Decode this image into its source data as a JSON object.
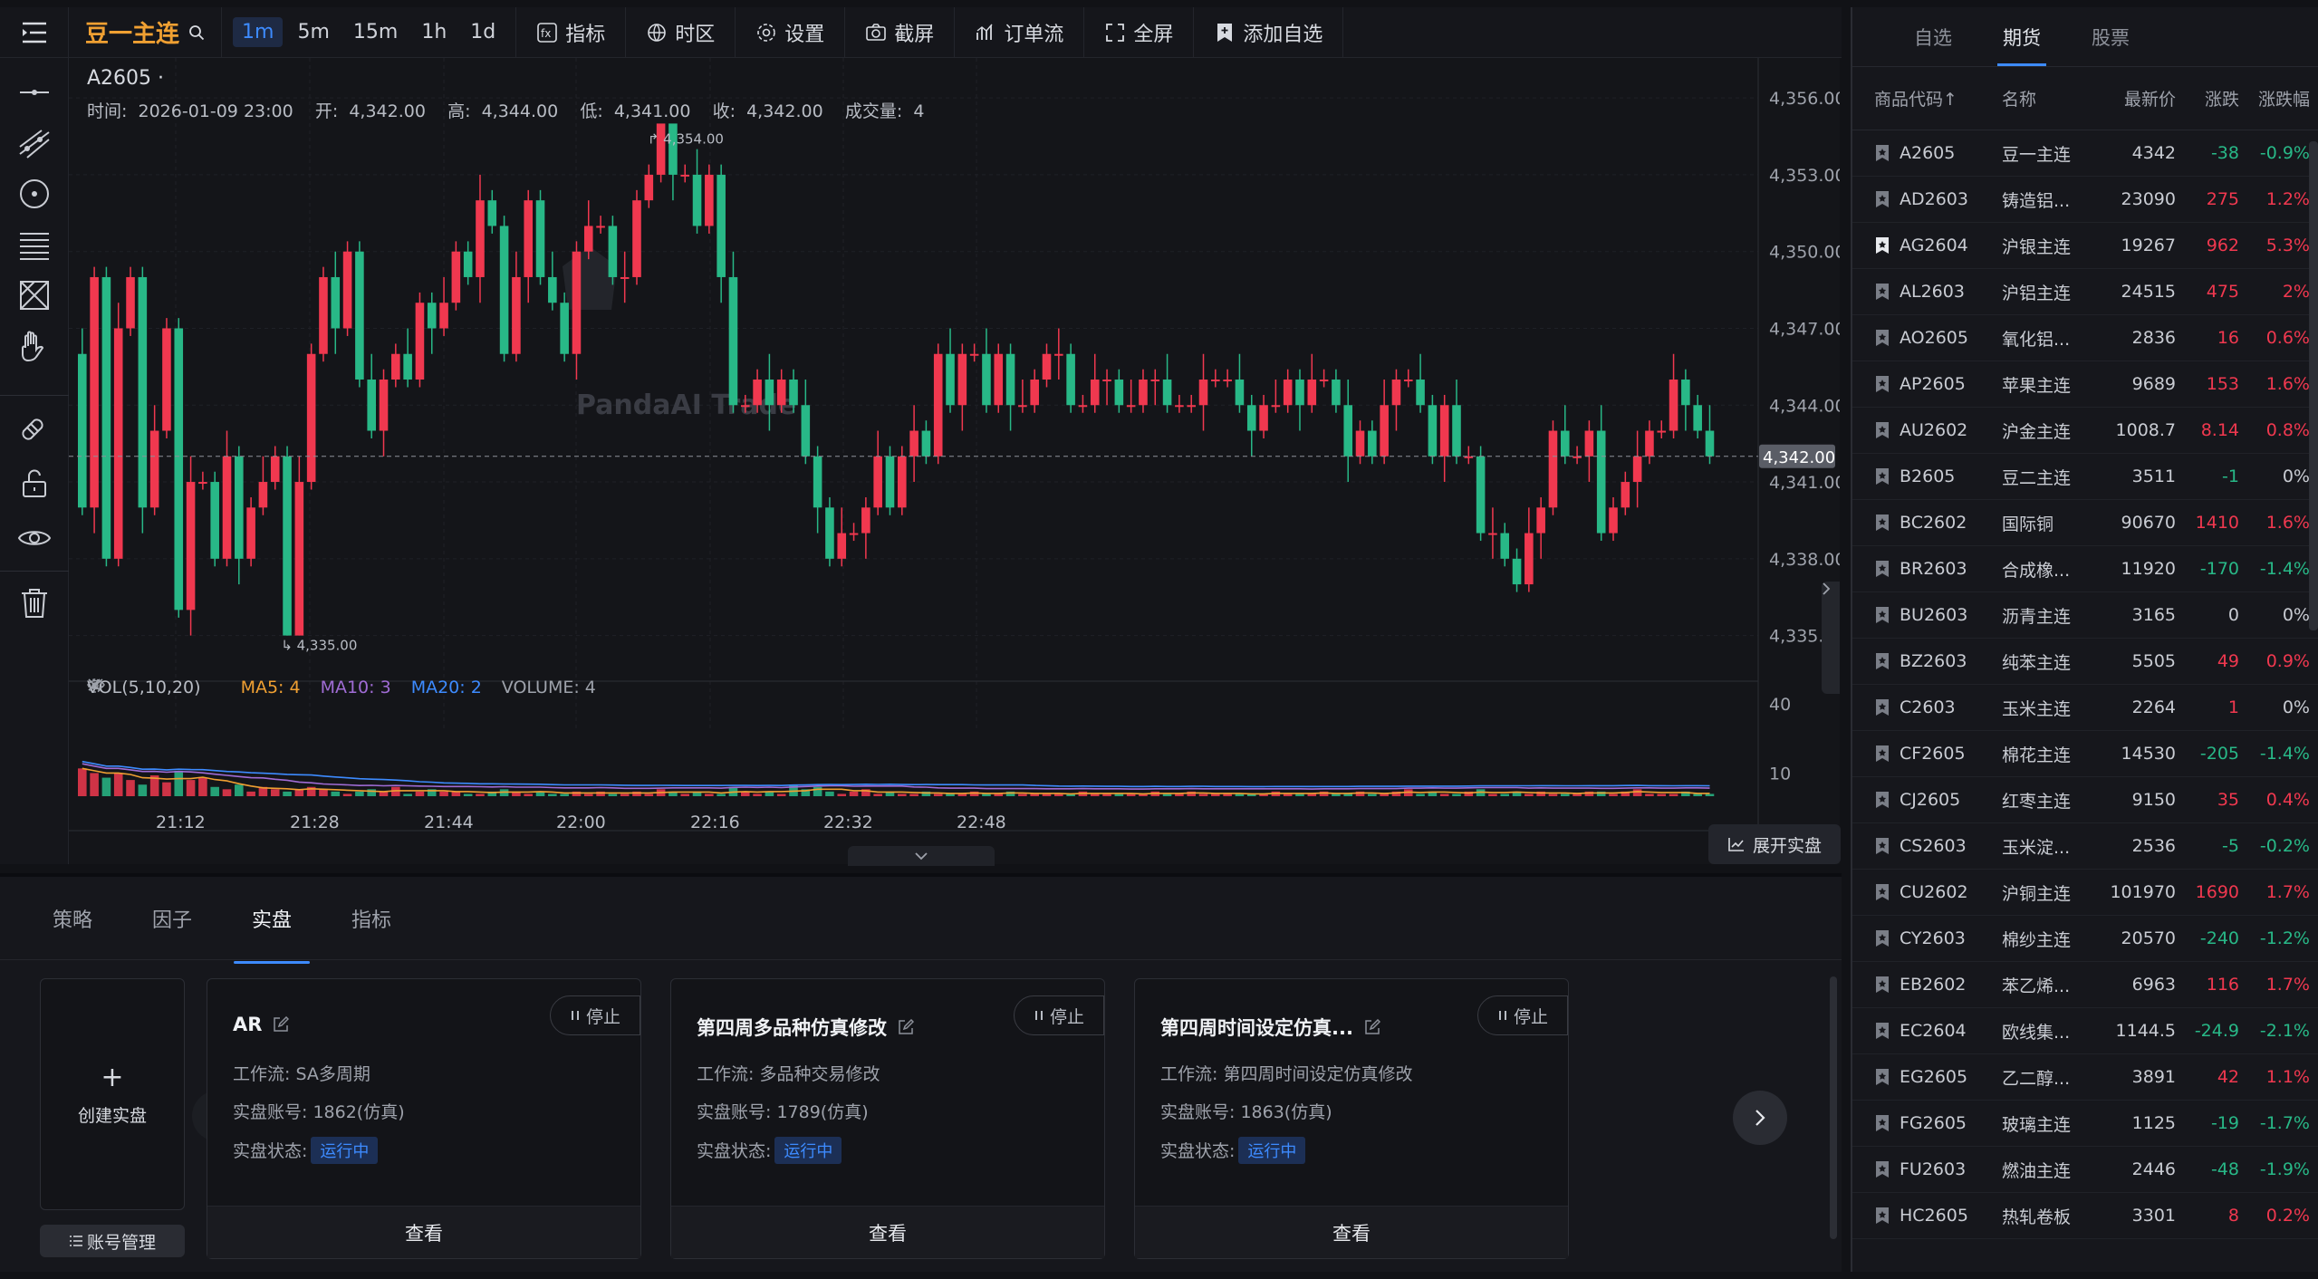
{
  "toolbar": {
    "symbol_name": "豆一主连",
    "periods": [
      "1m",
      "5m",
      "15m",
      "1h",
      "1d"
    ],
    "active_period": "1m",
    "tools": [
      {
        "label": "指标",
        "icon": "fx-icon"
      },
      {
        "label": "时区",
        "icon": "globe-icon"
      },
      {
        "label": "设置",
        "icon": "gear-icon"
      },
      {
        "label": "截屏",
        "icon": "camera-icon"
      },
      {
        "label": "订单流",
        "icon": "orderflow-icon"
      },
      {
        "label": "全屏",
        "icon": "fullscreen-icon"
      },
      {
        "label": "添加自选",
        "icon": "bookmark-add-icon"
      }
    ]
  },
  "chart": {
    "symbol_label": "A2605 ·",
    "ohlc_text": "时间:  2026-01-09 23:00    开:  4,342.00    高:  4,344.00    低:  4,341.00    收:  4,342.00    成交量:  4",
    "watermark": "PandaAI Trade",
    "last_price_label": "4,342.00",
    "high_marker": "4,354.00",
    "low_marker": "4,335.00",
    "vol_legend": {
      "title": "VOL(5,10,20)",
      "ma5": "MA5: 4",
      "ma10": "MA10: 3",
      "ma20": "MA20: 2",
      "volume": "VOLUME: 4"
    },
    "expand_label": "展开实盘"
  },
  "chart_data": {
    "type": "candlestick",
    "symbol": "A2605",
    "interval": "1m",
    "y_ticks": [
      "4,356.00",
      "4,353.00",
      "4,350.00",
      "4,347.00",
      "4,344.00",
      "4,341.00",
      "4,338.00",
      "4,335.00"
    ],
    "vol_ticks": [
      "40",
      "10"
    ],
    "x_ticks": [
      "21:12",
      "21:28",
      "21:44",
      "22:00",
      "22:16",
      "22:32",
      "22:48"
    ],
    "ylim": [
      4333.5,
      4356.5
    ],
    "last_close": 4342,
    "high": 4354,
    "low": 4335,
    "colors": {
      "up": "#f0384f",
      "down": "#28b887"
    },
    "series": [
      {
        "name": "close",
        "values": [
          4340,
          4349,
          4338,
          4347,
          4349,
          4340,
          4343,
          4347,
          4336,
          4341,
          4341,
          4338,
          4342,
          4338,
          4340,
          4341,
          4342,
          4335,
          4341,
          4346,
          4349,
          4347,
          4350,
          4345,
          4343,
          4345,
          4346,
          4345,
          4348,
          4347,
          4348,
          4350,
          4349,
          4352,
          4351,
          4346,
          4349,
          4352,
          4349,
          4348,
          4346,
          4350,
          4351,
          4351,
          4349,
          4349,
          4352,
          4353,
          4355,
          4353,
          4353,
          4351,
          4353,
          4349,
          4344,
          4344,
          4345,
          4344,
          4345,
          4344,
          4342,
          4340,
          4338,
          4339,
          4339,
          4340,
          4342,
          4340,
          4342,
          4343,
          4342,
          4346,
          4344,
          4346,
          4346,
          4344,
          4346,
          4344,
          4344,
          4345,
          4346,
          4346,
          4344,
          4344,
          4345,
          4345,
          4344,
          4344,
          4345,
          4345,
          4344,
          4344,
          4344,
          4345,
          4345,
          4345,
          4344,
          4343,
          4344,
          4344,
          4345,
          4344,
          4345,
          4345,
          4344,
          4342,
          4343,
          4342,
          4344,
          4345,
          4345,
          4344,
          4342,
          4344,
          4342,
          4342,
          4339,
          4339,
          4338,
          4337,
          4339,
          4340,
          4343,
          4342,
          4342,
          4343,
          4339,
          4340,
          4341,
          4342,
          4343,
          4343,
          4345,
          4344,
          4343,
          4342
        ]
      },
      {
        "name": "volume",
        "values": [
          12,
          10,
          8,
          10,
          7,
          5,
          9,
          6,
          11,
          7,
          8,
          4,
          3,
          5,
          2,
          4,
          3,
          2,
          3,
          4,
          3,
          2,
          1,
          2,
          3,
          2,
          4,
          1,
          2,
          3,
          2,
          2,
          1,
          1,
          2,
          3,
          2,
          1,
          2,
          1,
          1,
          2,
          1,
          2,
          1,
          1,
          2,
          1,
          3,
          2,
          1,
          2,
          1,
          1,
          4,
          2,
          1,
          2,
          1,
          5,
          3,
          4,
          2,
          1,
          2,
          3,
          1,
          2,
          1,
          1,
          2,
          1,
          1,
          1,
          2,
          1,
          1,
          2,
          1,
          1,
          1,
          1,
          1,
          2,
          1,
          1,
          1,
          1,
          1,
          2,
          1,
          1,
          2,
          1,
          1,
          1,
          1,
          1,
          1,
          2,
          1,
          1,
          1,
          2,
          1,
          1,
          2,
          1,
          1,
          2,
          3,
          1,
          2,
          1,
          1,
          2,
          3,
          1,
          1,
          2,
          1,
          2,
          1,
          1,
          1,
          2,
          2,
          1,
          2,
          3,
          1,
          1,
          1,
          2,
          1,
          1
        ]
      }
    ]
  },
  "bottom": {
    "tabs": [
      "策略",
      "因子",
      "实盘",
      "指标"
    ],
    "active_tab": "实盘",
    "create_label": "创建实盘",
    "account_manage": "账号管理",
    "cards": [
      {
        "title": "AR",
        "stop": "停止",
        "workflow": "工作流:  SA多周期",
        "account": "实盘账号:  1862(仿真)",
        "status_label": "实盘状态:",
        "status": "运行中",
        "view": "查看"
      },
      {
        "title": "第四周多品种仿真修改",
        "stop": "停止",
        "workflow": "工作流:  多品种交易修改",
        "account": "实盘账号:  1789(仿真)",
        "status_label": "实盘状态:",
        "status": "运行中",
        "view": "查看"
      },
      {
        "title": "第四周时间设定仿真...",
        "stop": "停止",
        "workflow": "工作流:  第四周时间设定仿真修改",
        "account": "实盘账号:  1863(仿真)",
        "status_label": "实盘状态:",
        "status": "运行中",
        "view": "查看"
      }
    ]
  },
  "watchlist": {
    "tabs": [
      "自选",
      "期货",
      "股票"
    ],
    "active_tab": "期货",
    "headers": [
      "商品代码↑",
      "名称",
      "最新价",
      "涨跌",
      "涨跌幅"
    ],
    "rows": [
      {
        "code": "A2605",
        "name": "豆一主连",
        "price": "4342",
        "chg": "-38",
        "pct": "-0.9%",
        "dir": "down",
        "starred": false
      },
      {
        "code": "AD2603",
        "name": "铸造铝...",
        "price": "23090",
        "chg": "275",
        "pct": "1.2%",
        "dir": "up",
        "starred": false
      },
      {
        "code": "AG2604",
        "name": "沪银主连",
        "price": "19267",
        "chg": "962",
        "pct": "5.3%",
        "dir": "up",
        "starred": true
      },
      {
        "code": "AL2603",
        "name": "沪铝主连",
        "price": "24515",
        "chg": "475",
        "pct": "2%",
        "dir": "up",
        "starred": false
      },
      {
        "code": "AO2605",
        "name": "氧化铝...",
        "price": "2836",
        "chg": "16",
        "pct": "0.6%",
        "dir": "up",
        "starred": false
      },
      {
        "code": "AP2605",
        "name": "苹果主连",
        "price": "9689",
        "chg": "153",
        "pct": "1.6%",
        "dir": "up",
        "starred": false
      },
      {
        "code": "AU2602",
        "name": "沪金主连",
        "price": "1008.7",
        "chg": "8.14",
        "pct": "0.8%",
        "dir": "up",
        "starred": false
      },
      {
        "code": "B2605",
        "name": "豆二主连",
        "price": "3511",
        "chg": "-1",
        "pct": "0%",
        "dir": "down",
        "starred": false
      },
      {
        "code": "BC2602",
        "name": "国际铜",
        "price": "90670",
        "chg": "1410",
        "pct": "1.6%",
        "dir": "up",
        "starred": false
      },
      {
        "code": "BR2603",
        "name": "合成橡...",
        "price": "11920",
        "chg": "-170",
        "pct": "-1.4%",
        "dir": "down",
        "starred": false
      },
      {
        "code": "BU2603",
        "name": "沥青主连",
        "price": "3165",
        "chg": "0",
        "pct": "0%",
        "dir": "flat",
        "starred": false
      },
      {
        "code": "BZ2603",
        "name": "纯苯主连",
        "price": "5505",
        "chg": "49",
        "pct": "0.9%",
        "dir": "up",
        "starred": false
      },
      {
        "code": "C2603",
        "name": "玉米主连",
        "price": "2264",
        "chg": "1",
        "pct": "0%",
        "dir": "up",
        "starred": false
      },
      {
        "code": "CF2605",
        "name": "棉花主连",
        "price": "14530",
        "chg": "-205",
        "pct": "-1.4%",
        "dir": "down",
        "starred": false
      },
      {
        "code": "CJ2605",
        "name": "红枣主连",
        "price": "9150",
        "chg": "35",
        "pct": "0.4%",
        "dir": "up",
        "starred": false
      },
      {
        "code": "CS2603",
        "name": "玉米淀...",
        "price": "2536",
        "chg": "-5",
        "pct": "-0.2%",
        "dir": "down",
        "starred": false
      },
      {
        "code": "CU2602",
        "name": "沪铜主连",
        "price": "101970",
        "chg": "1690",
        "pct": "1.7%",
        "dir": "up",
        "starred": false
      },
      {
        "code": "CY2603",
        "name": "棉纱主连",
        "price": "20570",
        "chg": "-240",
        "pct": "-1.2%",
        "dir": "down",
        "starred": false
      },
      {
        "code": "EB2602",
        "name": "苯乙烯...",
        "price": "6963",
        "chg": "116",
        "pct": "1.7%",
        "dir": "up",
        "starred": false
      },
      {
        "code": "EC2604",
        "name": "欧线集...",
        "price": "1144.5",
        "chg": "-24.9",
        "pct": "-2.1%",
        "dir": "down",
        "starred": false
      },
      {
        "code": "EG2605",
        "name": "乙二醇...",
        "price": "3891",
        "chg": "42",
        "pct": "1.1%",
        "dir": "up",
        "starred": false
      },
      {
        "code": "FG2605",
        "name": "玻璃主连",
        "price": "1125",
        "chg": "-19",
        "pct": "-1.7%",
        "dir": "down",
        "starred": false
      },
      {
        "code": "FU2603",
        "name": "燃油主连",
        "price": "2446",
        "chg": "-48",
        "pct": "-1.9%",
        "dir": "down",
        "starred": false
      },
      {
        "code": "HC2605",
        "name": "热轧卷板",
        "price": "3301",
        "chg": "8",
        "pct": "0.2%",
        "dir": "up",
        "starred": false
      }
    ]
  }
}
